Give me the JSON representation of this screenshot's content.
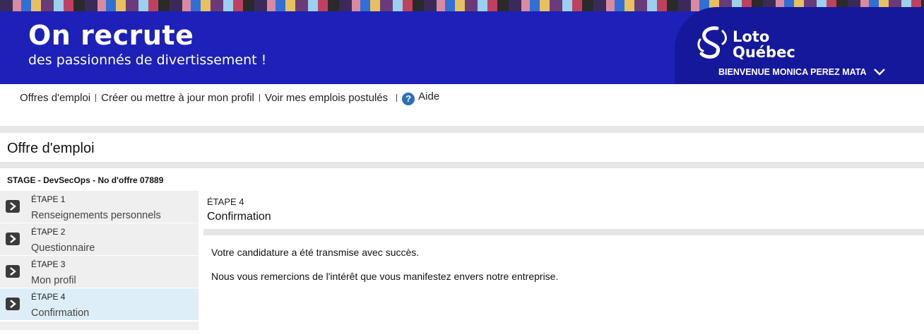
{
  "banner": {
    "title": "On recrute",
    "subtitle": "des passionnés de divertissement !",
    "brand_line1": "Loto",
    "brand_line2": "Québec",
    "welcome": "BIENVENUE MONICA PEREZ MATA",
    "colors": {
      "banner": "#1d21b8",
      "brand_panel": "#15189a"
    }
  },
  "nav": {
    "items": [
      {
        "label": "Offres d'emploi"
      },
      {
        "label": "Créer ou mettre à jour mon profil"
      },
      {
        "label": "Voir mes emplois postulés"
      }
    ],
    "help": {
      "label": "Aide",
      "icon": "help-icon"
    }
  },
  "page": {
    "title": "Offre d'emploi",
    "offer": "STAGE - DevSecOps - No d'offre 07889"
  },
  "steps": [
    {
      "number": "ÉTAPE 1",
      "name": "Renseignements personnels",
      "active": false
    },
    {
      "number": "ÉTAPE 2",
      "name": "Questionnaire",
      "active": false
    },
    {
      "number": "ÉTAPE 3",
      "name": "Mon profil",
      "active": false
    },
    {
      "number": "ÉTAPE 4",
      "name": "Confirmation",
      "active": true
    }
  ],
  "content": {
    "step": "ÉTAPE 4",
    "title": "Confirmation",
    "messages": [
      "Votre candidature a été transmise avec succès.",
      "Nous vous remercions de l'intérêt que vous manifestez envers notre entreprise."
    ]
  }
}
